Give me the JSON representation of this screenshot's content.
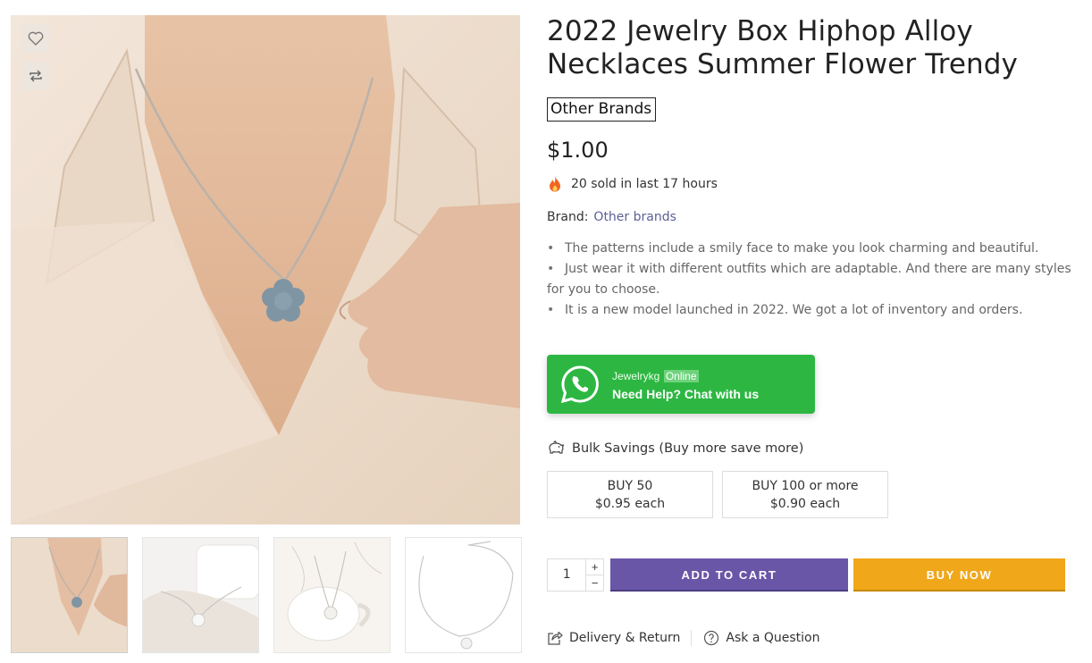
{
  "product": {
    "title": "2022 Jewelry Box Hiphop Alloy Necklaces Summer Flower Trendy",
    "vendor_badge": "Other Brands",
    "price": "$1.00",
    "sold_text": "20 sold in last 17 hours",
    "brand_label": "Brand:",
    "brand_value": "Other brands",
    "features": [
      "The patterns include a smily face to make you look charming and beautiful.",
      "Just wear it with different outfits which are adaptable. And there are many styles for you to choose.",
      "It is a new model launched in 2022. We got a lot of inventory and orders."
    ]
  },
  "gallery": {
    "thumbnails": [
      "necklace-worn",
      "necklace-on-box",
      "necklace-on-cup",
      "necklace-flat"
    ]
  },
  "whatsapp": {
    "name": "Jewelrykg",
    "status": "Online",
    "cta": "Need Help? Chat with us",
    "color": "#2db742"
  },
  "bulk": {
    "heading": "Bulk Savings (Buy more save more)",
    "tiers": [
      {
        "qty": "BUY 50",
        "price": "$0.95 each"
      },
      {
        "qty": "BUY 100 or more",
        "price": "$0.90 each"
      }
    ]
  },
  "purchase": {
    "quantity": "1",
    "plus": "+",
    "minus": "−",
    "add_to_cart": "ADD TO CART",
    "buy_now": "BUY NOW",
    "cart_color": "#6a56a7",
    "buy_color": "#f0a71a"
  },
  "links": {
    "delivery": "Delivery & Return",
    "ask": "Ask a Question"
  }
}
